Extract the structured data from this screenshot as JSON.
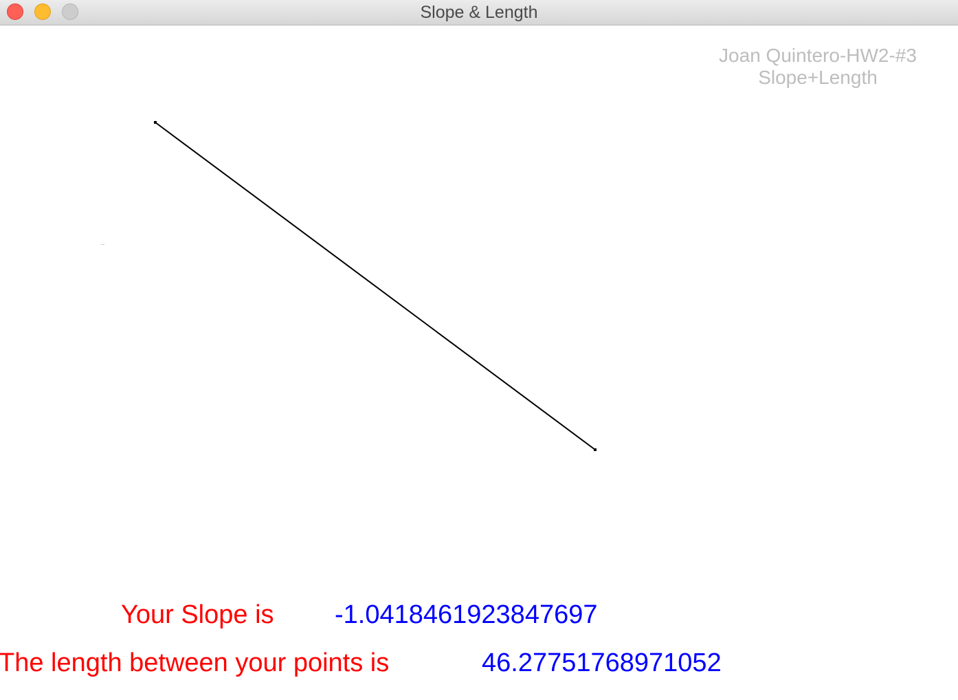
{
  "window": {
    "title": "Slope & Length"
  },
  "author": {
    "line1": "Joan Quintero-HW2-#3",
    "line2": "Slope+Length"
  },
  "slope": {
    "label": "Your Slope is",
    "value": "-1.0418461923847697"
  },
  "length": {
    "label": "The length between your points is",
    "value": "46.27751768971052"
  },
  "colors": {
    "label": "#ff0000",
    "value": "#0000ff",
    "author": "#bdbdbd",
    "line": "#000000"
  }
}
